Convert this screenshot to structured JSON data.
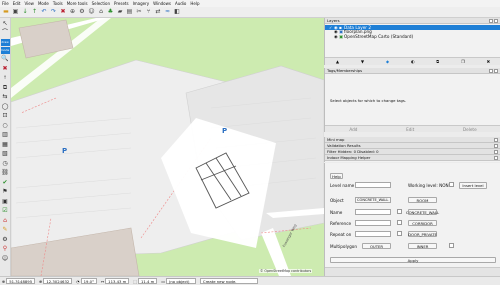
{
  "menu": [
    "File",
    "Edit",
    "View",
    "Mode",
    "Tools",
    "More tools",
    "Selection",
    "Presets",
    "Imagery",
    "Windows",
    "Audio",
    "Help"
  ],
  "left_tool_labels": [
    "draw",
    "mode"
  ],
  "layers_panel": {
    "title": "Layers",
    "layers": [
      {
        "name": "Data Layer 2"
      },
      {
        "name": "floorplan.png"
      },
      {
        "name": "OpenStreetMap Carto (Standard)"
      }
    ]
  },
  "tags_panel": {
    "title": "Tags/Memberships",
    "empty_text": "Select objects for which to change tags.",
    "buttons": [
      "Add",
      "Edit",
      "Delete"
    ]
  },
  "mini_panels": [
    "Mini map",
    "Validation Results",
    "Filter Hidden: 0 Disabled: 0",
    "Indoor Mapping Helper"
  ],
  "indoor_helper": {
    "help_label": "Help",
    "level_name_label": "Level name",
    "level_name_value": "",
    "working_level_label": "Working level: NONE",
    "insert_level_label": "Insert level",
    "object_label": "Object",
    "object_value": "CONCRETE_WALL",
    "room_label": "ROOM",
    "name_label": "Name",
    "concrete_wall_label": "CONCRETE_WALL",
    "reference_label": "Reference",
    "corridor_label": "CORRIDOR",
    "repeat_on_label": "Repeat on",
    "door_private_label": "DOOR_PRIVATE",
    "multipolygon_label": "Multipolygon",
    "outer_label": "OUTER",
    "inner_label": "INNER",
    "apply_label": "Apply"
  },
  "map": {
    "parking_label": "P",
    "street_label": "Fussinger Weg",
    "copyright": "© OpenStreetMap contributors"
  },
  "status": {
    "lat": "51.3148895",
    "lon": "12.3024632",
    "heading": "19.0°",
    "dist": "113.43 m",
    "area": "11.4 m",
    "selected": "(no object)",
    "message": "Create new node."
  },
  "colors": {
    "accent": "#1e7fd6",
    "map_green": "#cdebb0",
    "map_building": "#d9d0c9",
    "parking": "#eeeeee"
  }
}
